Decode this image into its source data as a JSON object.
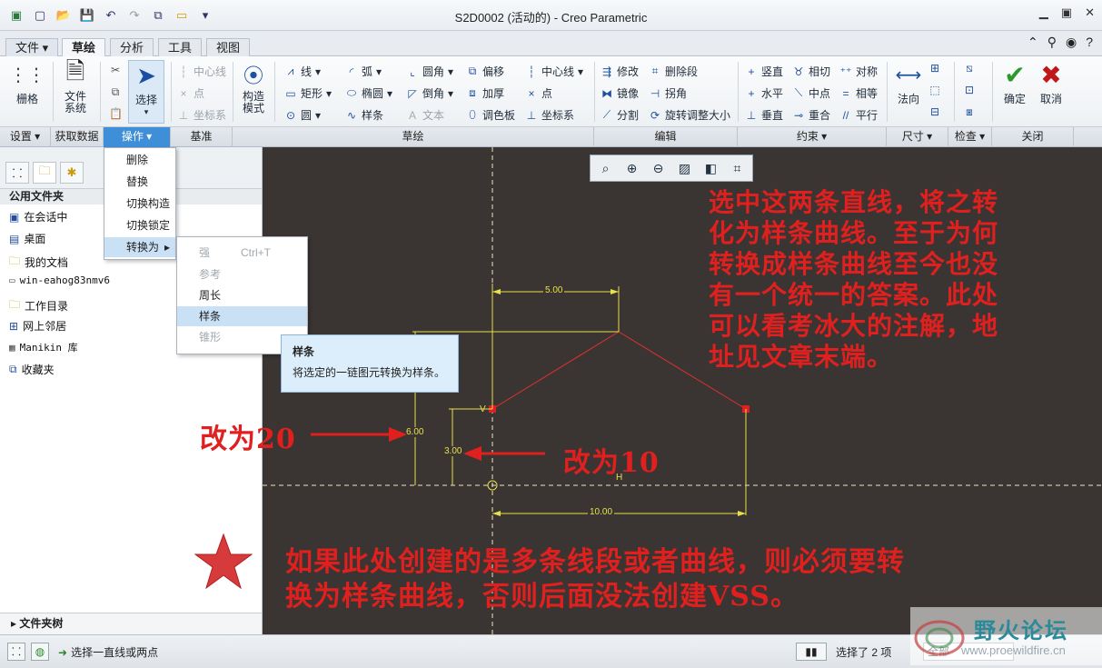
{
  "window": {
    "title": "S2D0002 (活动的) - Creo Parametric"
  },
  "menu_tabs": [
    "文件",
    "草绘",
    "分析",
    "工具",
    "视图"
  ],
  "ribbon": {
    "grid": "栅格",
    "file_system": [
      "文件",
      "系统"
    ],
    "select": "选择",
    "datum": [
      "中心线",
      "点",
      "坐标系"
    ],
    "construction_mode": [
      "构造",
      "模式"
    ],
    "sketch": {
      "col1": [
        "线",
        "矩形",
        "圆"
      ],
      "col2": [
        "弧",
        "椭圆",
        "样条"
      ],
      "col3": [
        "圆角",
        "倒角",
        "文本"
      ],
      "col4": [
        "偏移",
        "加厚",
        "调色板"
      ],
      "col5": [
        "中心线",
        "点",
        "坐标系"
      ]
    },
    "edit": {
      "col1": [
        "修改",
        "镜像",
        "分割"
      ],
      "col2": [
        "删除段",
        "拐角",
        "旋转调整大小"
      ]
    },
    "constrain": {
      "col1": [
        "竖直",
        "水平",
        "垂直"
      ],
      "col2": [
        "相切",
        "中点",
        "重合"
      ],
      "col3": [
        "对称",
        "相等",
        "平行"
      ]
    },
    "dimension": "法向",
    "ok": "确定",
    "cancel": "取消"
  },
  "group_labels": [
    "设置",
    "获取数据",
    "操作",
    "基准",
    "草绘",
    "编辑",
    "约束",
    "尺寸",
    "检查",
    "关闭"
  ],
  "left_panel": {
    "header": "公用文件夹",
    "items": [
      "在会话中",
      "桌面",
      "我的文档",
      "win-eahog83nmv6",
      "工作目录",
      "网上邻居",
      "Manikin 库",
      "收藏夹"
    ],
    "footer": "文件夹树"
  },
  "operations_menu": [
    "删除",
    "替换",
    "切换构造",
    "切换锁定",
    "转换为"
  ],
  "convert_submenu": [
    {
      "label": "强",
      "shortcut": "Ctrl+T",
      "enabled": false
    },
    {
      "label": "参考",
      "shortcut": "",
      "enabled": false
    },
    {
      "label": "周长",
      "shortcut": "",
      "enabled": true
    },
    {
      "label": "样条",
      "shortcut": "",
      "enabled": true
    },
    {
      "label": "锥形",
      "shortcut": "",
      "enabled": false
    }
  ],
  "tooltip": {
    "title": "样条",
    "desc": "将选定的一链图元转换为样条。"
  },
  "dims": {
    "top": "5.00",
    "left_big": "6.00",
    "left_small": "3.00",
    "bottom": "10.00",
    "v": "V",
    "h": "H"
  },
  "annotations": {
    "main": [
      "选中这两条直线，将之转",
      "化为样条曲线。至于为何",
      "转换成样条曲线至今也没",
      "有一个统一的答案。此处",
      "可以看考冰大的注解，地",
      "址见文章末端。"
    ],
    "change20": "改为20",
    "change10": "改为10",
    "bottom": [
      "如果此处创建的是多条线段或者曲线，则必须要转",
      "换为样条曲线，否则后面没法创建VSS。"
    ]
  },
  "status": {
    "prompt": "选择一直线或两点",
    "selected": "选择了 2 项",
    "filter": "全部"
  },
  "watermark": {
    "cn": "野火论坛",
    "url": "www.proewildfire.cn"
  }
}
